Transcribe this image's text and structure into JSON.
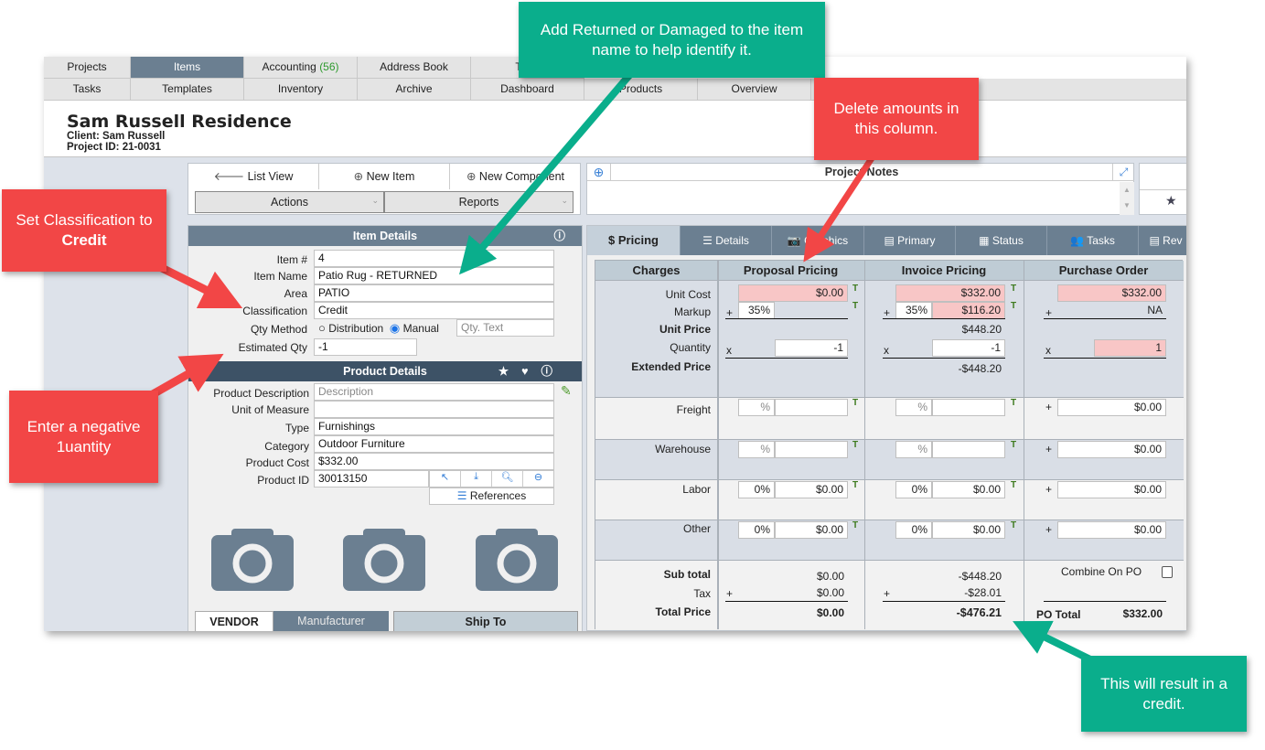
{
  "nav": {
    "row1": [
      {
        "label": "Projects"
      },
      {
        "label": "Items",
        "active": true
      },
      {
        "label": "Accounting",
        "badge": "(56)"
      },
      {
        "label": "Address Book"
      },
      {
        "label": "Time"
      }
    ],
    "row2": [
      {
        "label": "Tasks"
      },
      {
        "label": "Templates"
      },
      {
        "label": "Inventory"
      },
      {
        "label": "Archive"
      },
      {
        "label": "Dashboard"
      },
      {
        "label": "Products"
      },
      {
        "label": "Overview"
      }
    ]
  },
  "project": {
    "title": "Sam Russell Residence",
    "client": "Client: Sam Russell",
    "project_id": "Project ID: 21-0031"
  },
  "toolbar": {
    "list_view": "List View",
    "new_item": "New Item",
    "new_component": "New Component",
    "actions": "Actions",
    "reports": "Reports"
  },
  "notes": {
    "title": "Project Notes"
  },
  "item_details": {
    "title": "Item Details",
    "fields": [
      {
        "label": "Item #",
        "value": "4"
      },
      {
        "label": "Item Name",
        "value": "Patio Rug - RETURNED"
      },
      {
        "label": "Area",
        "value": "PATIO"
      },
      {
        "label": "Classification",
        "value": "Credit"
      }
    ],
    "qty_method": {
      "label": "Qty Method",
      "option1": "Distribution",
      "option2": "Manual",
      "selected": "Manual",
      "qty_text_placeholder": "Qty. Text"
    },
    "estimated_qty": {
      "label": "Estimated Qty",
      "value": "-1"
    }
  },
  "product_details": {
    "title": "Product Details",
    "description": {
      "label": "Product Description",
      "placeholder": "Description"
    },
    "unit_of_measure": {
      "label": "Unit of Measure",
      "value": ""
    },
    "type": {
      "label": "Type",
      "value": "Furnishings"
    },
    "category": {
      "label": "Category",
      "value": "Outdoor Furniture"
    },
    "product_cost": {
      "label": "Product Cost",
      "value": "$332.00"
    },
    "product_id": {
      "label": "Product ID",
      "value": "30013150"
    },
    "references": "References"
  },
  "bottom_tabs": {
    "vendor": "VENDOR",
    "manufacturer": "Manufacturer",
    "ship_to": "Ship To"
  },
  "pricing_tabs": [
    {
      "label": "Pricing",
      "icon": "$",
      "active": true
    },
    {
      "label": "Details",
      "icon": "☰"
    },
    {
      "label": "Graphics",
      "icon": "📷"
    },
    {
      "label": "Primary",
      "icon": "▤"
    },
    {
      "label": "Status",
      "icon": "▦"
    },
    {
      "label": "Tasks",
      "icon": "👥"
    },
    {
      "label": "Rev",
      "icon": "▤"
    }
  ],
  "pricing": {
    "headers": [
      "Charges",
      "Proposal Pricing",
      "Invoice Pricing",
      "Purchase Order"
    ],
    "labels": {
      "unit_cost": "Unit Cost",
      "markup": "Markup",
      "unit_price": "Unit Price",
      "quantity": "Quantity",
      "extended_price": "Extended Price",
      "freight": "Freight",
      "warehouse": "Warehouse",
      "labor": "Labor",
      "other": "Other",
      "sub_total": "Sub total",
      "tax": "Tax",
      "total_price": "Total Price",
      "combine_on_po": "Combine On PO",
      "po_total": "PO Total"
    },
    "proposal": {
      "unit_cost": "$0.00",
      "markup_pct": "35%",
      "quantity": "-1",
      "freight_pct": "%",
      "warehouse_pct": "%",
      "labor_pct": "0%",
      "labor": "$0.00",
      "other_pct": "0%",
      "other": "$0.00",
      "sub_total": "$0.00",
      "tax": "$0.00",
      "total": "$0.00"
    },
    "invoice": {
      "unit_cost": "$332.00",
      "markup_pct": "35%",
      "markup": "$116.20",
      "unit_price": "$448.20",
      "quantity": "-1",
      "extended_price": "-$448.20",
      "freight_pct": "%",
      "warehouse_pct": "%",
      "labor_pct": "0%",
      "labor": "$0.00",
      "other_pct": "0%",
      "other": "$0.00",
      "sub_total": "-$448.20",
      "tax": "-$28.01",
      "total": "-$476.21"
    },
    "po": {
      "unit_cost": "$332.00",
      "markup": "NA",
      "quantity": "1",
      "freight": "$0.00",
      "warehouse": "$0.00",
      "labor": "$0.00",
      "other": "$0.00",
      "po_total": "$332.00"
    },
    "symbols": {
      "plus": "+",
      "times": "x",
      "t": "T"
    }
  },
  "callouts": {
    "item_name": "Add Returned or Damaged to the item name to help identify it.",
    "delete_amounts": "Delete amounts in this column.",
    "classification_pre": "Set Classification to",
    "classification_bold": "Credit",
    "negative_qty": "Enter a negative 1uantity",
    "credit": "This will result in a credit."
  },
  "colors": {
    "callout_green": "#0aae8c",
    "callout_red": "#f24646",
    "header_slate": "#6b7f91",
    "highlight_pink": "#f8c6c6"
  }
}
